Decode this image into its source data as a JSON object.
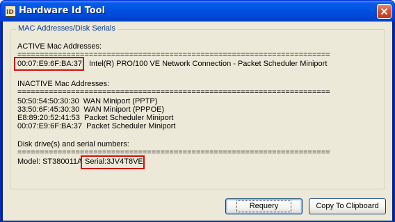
{
  "window": {
    "title": "Hardware Id Tool"
  },
  "group": {
    "title": "MAC Addresses/Disk Serials"
  },
  "output": {
    "active_header": "ACTIVE Mac Addresses:",
    "sep1": "================================================================================",
    "active_mac": "00:07:E9:6F:BA:37",
    "active_desc": "Intel(R) PRO/100 VE Network Connection - Packet Scheduler Miniport",
    "inactive_header": "INACTIVE Mac Addresses:",
    "sep2": "================================================================================",
    "inactive_lines": [
      "50:50:54:50:30:30  WAN Miniport (PPTP)",
      "33:50:6F:45:30:30  WAN Miniport (PPPOE)",
      "E8:89:20:52:41:53  Packet Scheduler Miniport",
      "00:07:E9:6F:BA:37  Packet Scheduler Miniport"
    ],
    "disk_header": "Disk drive(s) and serial numbers:",
    "sep3": "================================================================================",
    "disk_model": "Model: ST380011A",
    "disk_serial": "Serial:3JV4T8VE"
  },
  "buttons": {
    "requery": "Requery",
    "copy": "Copy To Clipboard"
  },
  "colors": {
    "highlight": "#cc1111",
    "titlebar": "#0054e3",
    "dialog_bg": "#ece9d8"
  },
  "icons": {
    "app": "hwid-app-icon",
    "close": "close-icon"
  }
}
